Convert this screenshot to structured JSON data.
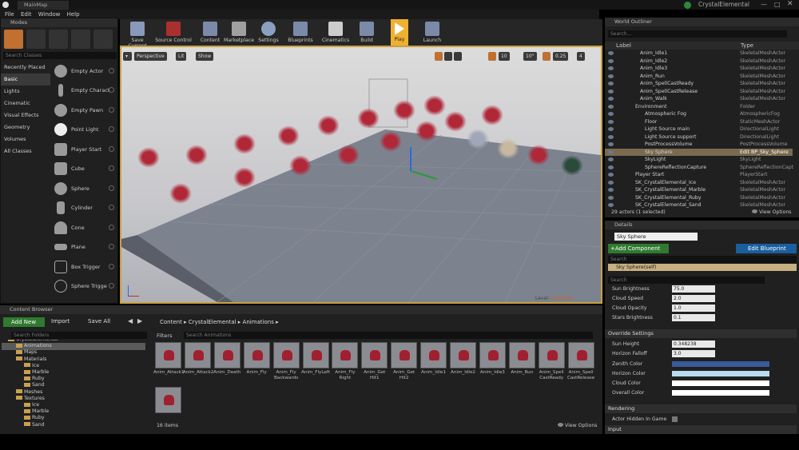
{
  "window": {
    "tab": "MainMap",
    "project": "CrystalElemental"
  },
  "menu": [
    "File",
    "Edit",
    "Window",
    "Help"
  ],
  "modes": {
    "tab": "Modes",
    "search_placeholder": "Search Classes",
    "categories": [
      "Recently Placed",
      "Basic",
      "Lights",
      "Cinematic",
      "Visual Effects",
      "Geometry",
      "Volumes",
      "All Classes"
    ],
    "selected_category": "Basic",
    "items": [
      "Empty Actor",
      "Empty Charact",
      "Empty Pawn",
      "Point Light",
      "Player Start",
      "Cube",
      "Sphere",
      "Cylinder",
      "Cone",
      "Plane",
      "Box Trigger",
      "Sphere Trigge"
    ]
  },
  "toolbar": [
    "Save Current",
    "Source Control",
    "Content",
    "Marketplace",
    "Settings",
    "Blueprints",
    "Cinematics",
    "Build",
    "Play",
    "Launch"
  ],
  "viewport": {
    "perspective": "Perspective",
    "lit": "Lit",
    "show": "Show",
    "grid": "10",
    "rot": "10°",
    "scale": "0.25",
    "cam": "4",
    "level_label": "Level:",
    "level_name": "MainMap (Persistent)"
  },
  "outliner": {
    "tab": "World Outliner",
    "search_placeholder": "Search...",
    "col_label": "Label",
    "col_type": "Type",
    "rows": [
      {
        "label": "Anim_Idle1",
        "type": "SkeletalMeshActor",
        "indent": 1
      },
      {
        "label": "Anim_Idle2",
        "type": "SkeletalMeshActor",
        "indent": 1
      },
      {
        "label": "Anim_Idle3",
        "type": "SkeletalMeshActor",
        "indent": 1
      },
      {
        "label": "Anim_Run",
        "type": "SkeletalMeshActor",
        "indent": 1
      },
      {
        "label": "Anim_SpellCastReady",
        "type": "SkeletalMeshActor",
        "indent": 1
      },
      {
        "label": "Anim_SpellCastRelease",
        "type": "SkeletalMeshActor",
        "indent": 1
      },
      {
        "label": "Anim_Walk",
        "type": "SkeletalMeshActor",
        "indent": 1
      },
      {
        "label": "Environment",
        "type": "Folder",
        "indent": 0
      },
      {
        "label": "Atmospheric Fog",
        "type": "AtmosphericFog",
        "indent": 2
      },
      {
        "label": "Floor",
        "type": "StaticMeshActor",
        "indent": 2
      },
      {
        "label": "Light Source main",
        "type": "DirectionalLight",
        "indent": 2
      },
      {
        "label": "Light Source support",
        "type": "DirectionalLight",
        "indent": 2
      },
      {
        "label": "PostProcessVolume",
        "type": "PostProcessVolume",
        "indent": 2
      },
      {
        "label": "Sky Sphere",
        "type": "Edit BP_Sky_Sphere",
        "indent": 2,
        "selected": true
      },
      {
        "label": "SkyLight",
        "type": "SkyLight",
        "indent": 2
      },
      {
        "label": "SphereReflectionCapture",
        "type": "SphereReflectionCapt",
        "indent": 2
      },
      {
        "label": "Player Start",
        "type": "PlayerStart",
        "indent": 0
      },
      {
        "label": "SK_CrystalElemental_Ice",
        "type": "SkeletalMeshActor",
        "indent": 0
      },
      {
        "label": "SK_CrystalElemental_Marble",
        "type": "SkeletalMeshActor",
        "indent": 0
      },
      {
        "label": "SK_CrystalElemental_Ruby",
        "type": "SkeletalMeshActor",
        "indent": 0
      },
      {
        "label": "SK_CrystalElemental_Sand",
        "type": "SkeletalMeshActor",
        "indent": 0
      }
    ],
    "status": "29 actors (1 selected)",
    "view_options": "View Options"
  },
  "details": {
    "tab": "Details",
    "name": "Sky Sphere",
    "add_component": "+Add Component",
    "edit_blueprint": "Edit Blueprint",
    "search_placeholder": "Search",
    "self_label": "Sky Sphere(self)",
    "search2_placeholder": "Search",
    "props": [
      {
        "name": "Sun Brightness",
        "value": "75.0"
      },
      {
        "name": "Cloud Speed",
        "value": "2.0"
      },
      {
        "name": "Cloud Opacity",
        "value": "1.0"
      },
      {
        "name": "Stars Brightness",
        "value": "0.1"
      }
    ],
    "override_header": "Override Settings",
    "override": [
      {
        "name": "Sun Height",
        "value": "0.348238"
      },
      {
        "name": "Horizon Falloff",
        "value": "3.0"
      }
    ],
    "colors": [
      {
        "name": "Zenith Color",
        "color": "#3a5a9a"
      },
      {
        "name": "Horizon Color",
        "color": "#b8dcf0"
      },
      {
        "name": "Cloud Color",
        "color": "#ffffff"
      },
      {
        "name": "Overall Color",
        "color": "#ffffff"
      }
    ],
    "rendering_header": "Rendering",
    "actor_hidden": "Actor Hidden In Game",
    "input_header": "Input"
  },
  "content_browser": {
    "tab": "Content Browser",
    "add_new": "Add New",
    "import": "Import",
    "save_all": "Save All",
    "path": [
      "Content",
      "CrystalElemental",
      "Animations"
    ],
    "search_folders": "Search Folders",
    "filters": "Filters",
    "search_assets": "Search Animations",
    "tree": [
      {
        "label": "CrystalElemental",
        "indent": 0
      },
      {
        "label": "Animations",
        "indent": 1,
        "selected": true
      },
      {
        "label": "Maps",
        "indent": 1
      },
      {
        "label": "Materials",
        "indent": 1
      },
      {
        "label": "Ice",
        "indent": 2
      },
      {
        "label": "Marble",
        "indent": 2
      },
      {
        "label": "Ruby",
        "indent": 2
      },
      {
        "label": "Sand",
        "indent": 2
      },
      {
        "label": "Meshes",
        "indent": 1
      },
      {
        "label": "Textures",
        "indent": 1
      },
      {
        "label": "Ice",
        "indent": 2
      },
      {
        "label": "Marble",
        "indent": 2
      },
      {
        "label": "Ruby",
        "indent": 2
      },
      {
        "label": "Sand",
        "indent": 2
      }
    ],
    "assets": [
      "Anim_Attack1",
      "Anim_Attack2",
      "Anim_Death",
      "Anim_Fly",
      "Anim_Fly Backwards",
      "Anim_FlyLeft",
      "Anim_Fly Right",
      "Anim_Get Hit1",
      "Anim_Get Hit2",
      "Anim_Idle1",
      "Anim_Idle2",
      "Anim_Idle3",
      "Anim_Run",
      "Anim_Spell CastReady",
      "Anim_Spell CastRelease",
      "Anim_Walk"
    ],
    "count": "16 items",
    "view_options": "View Options"
  }
}
